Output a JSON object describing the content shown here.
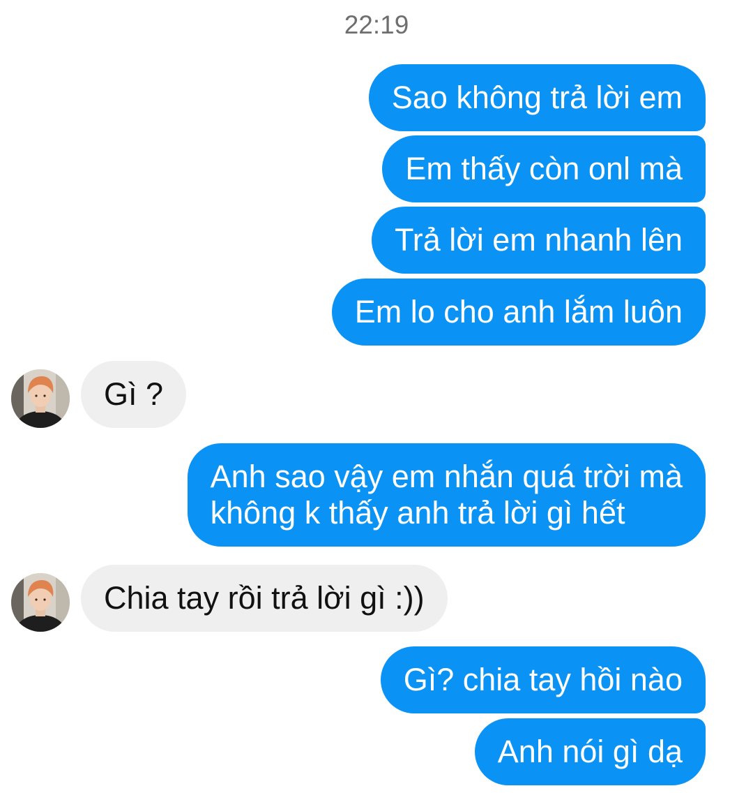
{
  "timestamp": "22:19",
  "colors": {
    "sent_bubble": "#0a93f5",
    "received_bubble": "#efefef"
  },
  "messages": [
    {
      "from": "me",
      "text": "Sao không trả lời em"
    },
    {
      "from": "me",
      "text": "Em thấy còn onl mà"
    },
    {
      "from": "me",
      "text": "Trả lời em nhanh lên"
    },
    {
      "from": "me",
      "text": "Em lo cho anh lắm luôn"
    },
    {
      "from": "contact",
      "text": "Gì ?"
    },
    {
      "from": "me",
      "lines": [
        "Anh sao vậy em nhắn quá trời mà",
        "không k thấy anh trả lời gì hết"
      ]
    },
    {
      "from": "contact",
      "text": "Chia tay rồi trả lời gì :))"
    },
    {
      "from": "me",
      "text": "Gì? chia tay hồi nào"
    },
    {
      "from": "me",
      "text": "Anh nói gì dạ"
    }
  ]
}
